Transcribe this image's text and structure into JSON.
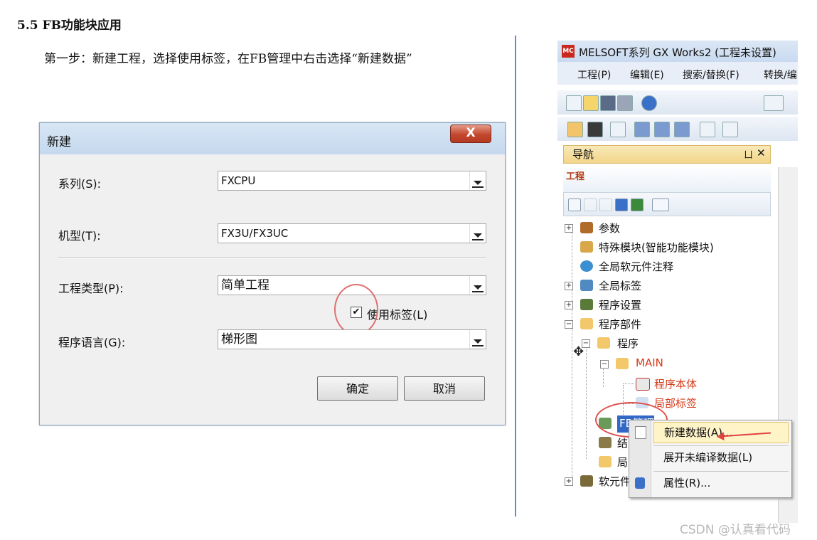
{
  "doc": {
    "heading": "5.5 FB功能块应用",
    "step": "第一步：新建工程，选择使用标签，在FB管理中右击选择“新建数据”"
  },
  "dialog": {
    "title": "新建",
    "close_glyph": "X",
    "fields": [
      {
        "label": "系列(S):",
        "value": "FXCPU"
      },
      {
        "label": "机型(T):",
        "value": "FX3U/FX3UC"
      },
      {
        "label": "工程类型(P):",
        "value": "简单工程"
      },
      {
        "label": "程序语言(G):",
        "value": "梯形图"
      }
    ],
    "use_label_checkbox": {
      "label": "使用标签(L)",
      "checked": true,
      "mark": "✔"
    },
    "ok_label": "确定",
    "cancel_label": "取消"
  },
  "gx": {
    "title": "MELSOFT系列 GX Works2 (工程未设置)",
    "logo": "MC",
    "menu": [
      "工程(P)",
      "编辑(E)",
      "搜索/替换(F)",
      "转换/编"
    ],
    "nav": {
      "title": "导航",
      "pin": "ㄩ",
      "close": "✕"
    },
    "project_header": "工程",
    "tree": [
      {
        "label": "参数",
        "expander": "+"
      },
      {
        "label": "特殊模块(智能功能模块)",
        "expander": ""
      },
      {
        "label": "全局软元件注释",
        "expander": ""
      },
      {
        "label": "全局标签",
        "expander": "+"
      },
      {
        "label": "程序设置",
        "expander": "+"
      },
      {
        "label": "程序部件",
        "expander": "−"
      },
      {
        "label": "程序",
        "expander": "−"
      },
      {
        "label": "MAIN",
        "expander": "−"
      },
      {
        "label": "程序本体",
        "expander": ""
      },
      {
        "label": "局部标签",
        "expander": ""
      },
      {
        "label": "FB管理",
        "expander": ""
      },
      {
        "label": "结",
        "expander": ""
      },
      {
        "label": "局",
        "expander": ""
      },
      {
        "label": "软元件",
        "expander": "+"
      }
    ],
    "context_menu": [
      "新建数据(A)...",
      "展开未编译数据(L)",
      "属性(R)..."
    ]
  },
  "watermark": "CSDN @认真看代码",
  "colors": {
    "red_label": "#d43a1a",
    "selection": "#3168c6",
    "annotation_circle": "#e05050"
  }
}
